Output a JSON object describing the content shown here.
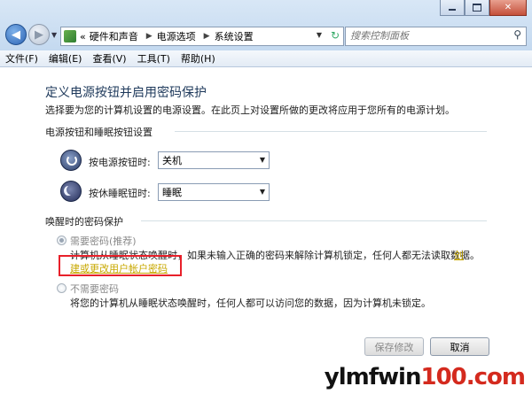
{
  "address": {
    "crumbs": [
      "硬件和声音",
      "电源选项",
      "系统设置"
    ],
    "lead": "«"
  },
  "search": {
    "placeholder": "搜索控制面板"
  },
  "menu": [
    "文件(F)",
    "编辑(E)",
    "查看(V)",
    "工具(T)",
    "帮助(H)"
  ],
  "page": {
    "title": "定义电源按钮并启用密码保护",
    "description": "选择要为您的计算机设置的电源设置。在此页上对设置所做的更改将应用于您所有的电源计划。"
  },
  "power_section": {
    "title": "电源按钮和睡眠按钮设置",
    "power_button_label": "按电源按钮时:",
    "power_button_value": "关机",
    "sleep_button_label": "按休睡眠钮时:",
    "sleep_button_value": "睡眠"
  },
  "password_section": {
    "title": "唤醒时的密码保护",
    "require_label": "需要密码(推荐)",
    "require_desc": "计算机从睡眠状态唤醒时，如果未输入正确的密码来解除计算机锁定，任何人都无法读取数据。",
    "require_link_part1": "创",
    "require_link_part2": "建或更改用户帐户密码",
    "no_password_label": "不需要密码",
    "no_password_desc": "将您的计算机从睡眠状态唤醒时，任何人都可以访问您的数据，因为计算机未锁定。",
    "selected": "require"
  },
  "buttons": {
    "save": "保存修改",
    "cancel": "取消"
  },
  "watermark": {
    "main": "ylmfwin",
    "tld": "100.com"
  },
  "colors": {
    "title_blue": "#1e395b",
    "link": "#c8a800",
    "highlight": "#e8202a"
  }
}
